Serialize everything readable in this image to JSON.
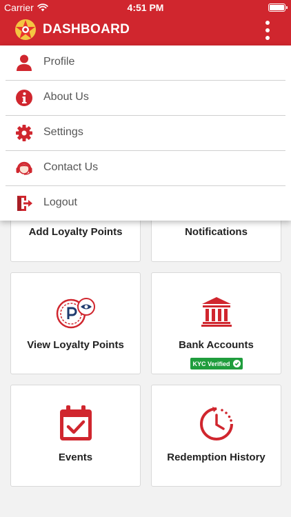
{
  "status_bar": {
    "carrier": "Carrier",
    "time": "4:51 PM"
  },
  "app_bar": {
    "title": "DASHBOARD"
  },
  "menu": {
    "items": [
      {
        "label": "Profile",
        "icon": "user-icon"
      },
      {
        "label": "About Us",
        "icon": "info-icon"
      },
      {
        "label": "Settings",
        "icon": "gear-icon"
      },
      {
        "label": "Contact Us",
        "icon": "headset-icon"
      },
      {
        "label": "Logout",
        "icon": "logout-icon"
      }
    ]
  },
  "dashboard": {
    "cards": [
      {
        "label": "Add Loyalty Points"
      },
      {
        "label": "Notifications"
      },
      {
        "label": "View Loyalty Points",
        "icon": "loyalty-coin-eye-icon"
      },
      {
        "label": "Bank Accounts",
        "icon": "bank-icon",
        "badge": "KYC Verified"
      },
      {
        "label": "Events",
        "icon": "calendar-check-icon"
      },
      {
        "label": "Redemption History",
        "icon": "clock-history-icon"
      }
    ]
  },
  "colors": {
    "brand": "#d0262e",
    "navy": "#1f3b6e",
    "verified": "#1f9d3d"
  }
}
